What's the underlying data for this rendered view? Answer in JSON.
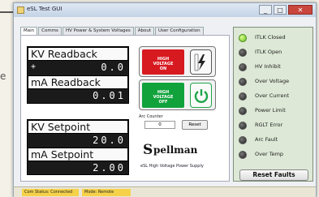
{
  "background": {
    "text": "e"
  },
  "window": {
    "title": "eSL Test GUI",
    "min_label": "_",
    "max_label": "□",
    "close_label": "✕"
  },
  "tabs": [
    {
      "label": "Main"
    },
    {
      "label": "Comms"
    },
    {
      "label": "HV Power & System Voltages"
    },
    {
      "label": "About"
    },
    {
      "label": "User Configuration"
    }
  ],
  "readbacks": {
    "kv_label": "KV Readback",
    "kv_sign": "+",
    "kv_value": "0.0",
    "ma_label": "mA Readback",
    "ma_value": "0.01"
  },
  "setpoints": {
    "kv_label": "KV Setpoint",
    "kv_value": "20.0",
    "ma_label": "mA Setpoint",
    "ma_value": "2.00"
  },
  "hv_on": {
    "line1": "HIGH",
    "line2": "VOLTAGE",
    "line3": "ON",
    "icon": "lightning-icon"
  },
  "hv_off": {
    "line1": "HIGH",
    "line2": "VOLTAGE",
    "line3": "OFF",
    "icon": "power-icon"
  },
  "arc": {
    "label": "Arc Counter",
    "value": "0",
    "reset_label": "Reset"
  },
  "brand": {
    "mark": "S",
    "name": "pellman",
    "tagline": "eSL High Voltage Power Supply"
  },
  "status": [
    {
      "label": "ITLK Closed",
      "on": true
    },
    {
      "label": "ITLK Open",
      "on": false
    },
    {
      "label": "HV Inhibit",
      "on": false
    },
    {
      "label": "Over Voltage",
      "on": false
    },
    {
      "label": "Over Current",
      "on": false
    },
    {
      "label": "Power Limit",
      "on": false
    },
    {
      "label": "RGLT Error",
      "on": false
    },
    {
      "label": "Arc Fault",
      "on": false
    },
    {
      "label": "Over Temp",
      "on": false
    }
  ],
  "reset_faults_label": "Reset Faults",
  "statusbar": {
    "connection": "Com Status: Connected",
    "mode": "Mode: Remote"
  },
  "colors": {
    "hv_on": "#d71920",
    "hv_off": "#11a23c",
    "led_on": "#8fd23c",
    "status_panel": "#dde8d6"
  }
}
